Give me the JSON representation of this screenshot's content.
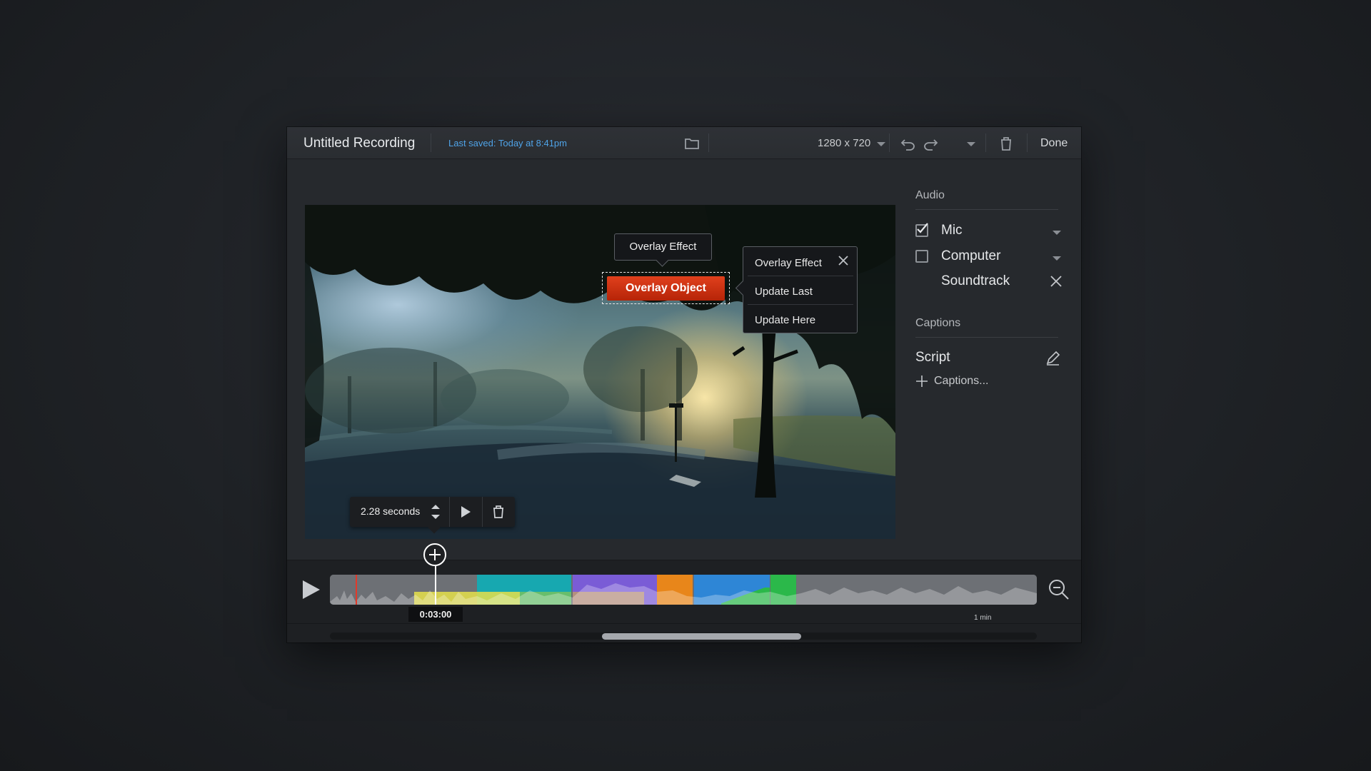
{
  "header": {
    "title": "Untitled Recording",
    "last_saved": "Last saved: Today at 8:41pm",
    "resolution": "1280 x 720",
    "done_label": "Done",
    "icons": [
      "folder-icon",
      "chevron-down-icon",
      "undo-icon",
      "redo-icon",
      "trash-icon"
    ]
  },
  "video": {
    "tooltip_label": "Overlay Effect",
    "overlay_button_label": "Overlay Object",
    "popup": {
      "title": "Overlay Effect",
      "items": [
        "Update Last",
        "Update Here"
      ]
    },
    "duration_label": "2.28 seconds"
  },
  "sidebar": {
    "audio_heading": "Audio",
    "audio_items": [
      {
        "label": "Mic",
        "checked": true
      },
      {
        "label": "Computer",
        "checked": false
      },
      {
        "label": "Soundtrack"
      }
    ],
    "captions_heading": "Captions",
    "script_label": "Script",
    "add_captions_label": "Captions..."
  },
  "timeline": {
    "playhead_time": "0:03:00",
    "scale_label": "1 min",
    "segment_colors": [
      "#6a6d72",
      "#17a8b0",
      "#7a5cd6",
      "#e8861a",
      "#2e86d6",
      "#2bb84a",
      "#6a6d72"
    ],
    "highlight_color": "#e6e04a"
  },
  "colors": {
    "accent_blue": "#4fa3e8",
    "overlay_red": "#d23414"
  }
}
